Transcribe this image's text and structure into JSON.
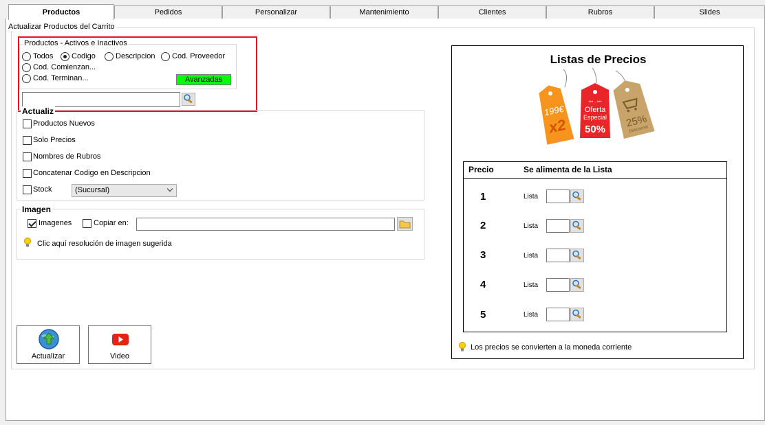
{
  "tabs": [
    {
      "label": "Productos",
      "active": true
    },
    {
      "label": "Pedidos",
      "active": false
    },
    {
      "label": "Personalizar",
      "active": false
    },
    {
      "label": "Mantenimiento",
      "active": false
    },
    {
      "label": "Clientes",
      "active": false
    },
    {
      "label": "Rubros",
      "active": false
    },
    {
      "label": "Slides",
      "active": false
    }
  ],
  "section_title": "Actualizar Productos del Carrito",
  "productos_group": {
    "title": "Productos - Activos e Inactivos",
    "radios": [
      {
        "label": "Todos",
        "checked": false
      },
      {
        "label": "Codigo",
        "checked": true
      },
      {
        "label": "Descripcion",
        "checked": false
      },
      {
        "label": "Cod. Proveedor",
        "checked": false
      },
      {
        "label": "Cod. Comienzan...",
        "checked": false
      },
      {
        "label": "Cod. Terminan...",
        "checked": false
      }
    ],
    "advanced_button": "Avanzadas",
    "advanced_color": "#00ff00",
    "search_value": "",
    "search_icon": "search-icon"
  },
  "actualiz_group": {
    "title": "Actualiz",
    "checks": [
      {
        "label": "Productos Nuevos",
        "checked": false
      },
      {
        "label": "Solo Precios",
        "checked": false
      },
      {
        "label": "Nombres de Rubros",
        "checked": false
      },
      {
        "label": "Concatenar Codigo en Descripcion",
        "checked": false
      },
      {
        "label": "Stock",
        "checked": false
      }
    ],
    "sucursal_selected": "(Sucursal)"
  },
  "imagen_group": {
    "title": "Imagen",
    "imagenes_label": "Imagenes",
    "imagenes_checked": true,
    "copiar_label": "Copiar en:",
    "copiar_checked": false,
    "copiar_value": "",
    "folder_icon": "folder-icon",
    "hint": "Clic aquí resolución de imagen sugerida",
    "hint_icon": "lightbulb-icon"
  },
  "buttons": {
    "actualizar": "Actualizar",
    "actualizar_icon": "globe-upload-icon",
    "video": "Video",
    "video_icon": "youtube-icon"
  },
  "prices_panel": {
    "title": "Listas de Precios",
    "tags": [
      {
        "lines": [
          "199€",
          "x2"
        ],
        "color": "#f7941d"
      },
      {
        "lines": [
          "Oferta",
          "Especial",
          "50%"
        ],
        "color": "#e8262a"
      },
      {
        "lines": [
          "25%",
          "Descuento"
        ],
        "color": "#c8a46a"
      }
    ],
    "tag_stars": "*** · ***",
    "col_precio": "Precio",
    "col_lista": "Se alimenta de la Lista",
    "rows": [
      {
        "num": "1",
        "label": "Lista",
        "value": ""
      },
      {
        "num": "2",
        "label": "Lista",
        "value": ""
      },
      {
        "num": "3",
        "label": "Lista",
        "value": ""
      },
      {
        "num": "4",
        "label": "Lista",
        "value": ""
      },
      {
        "num": "5",
        "label": "Lista",
        "value": ""
      }
    ],
    "footer": "Los precios se convierten a la moneda corriente"
  }
}
